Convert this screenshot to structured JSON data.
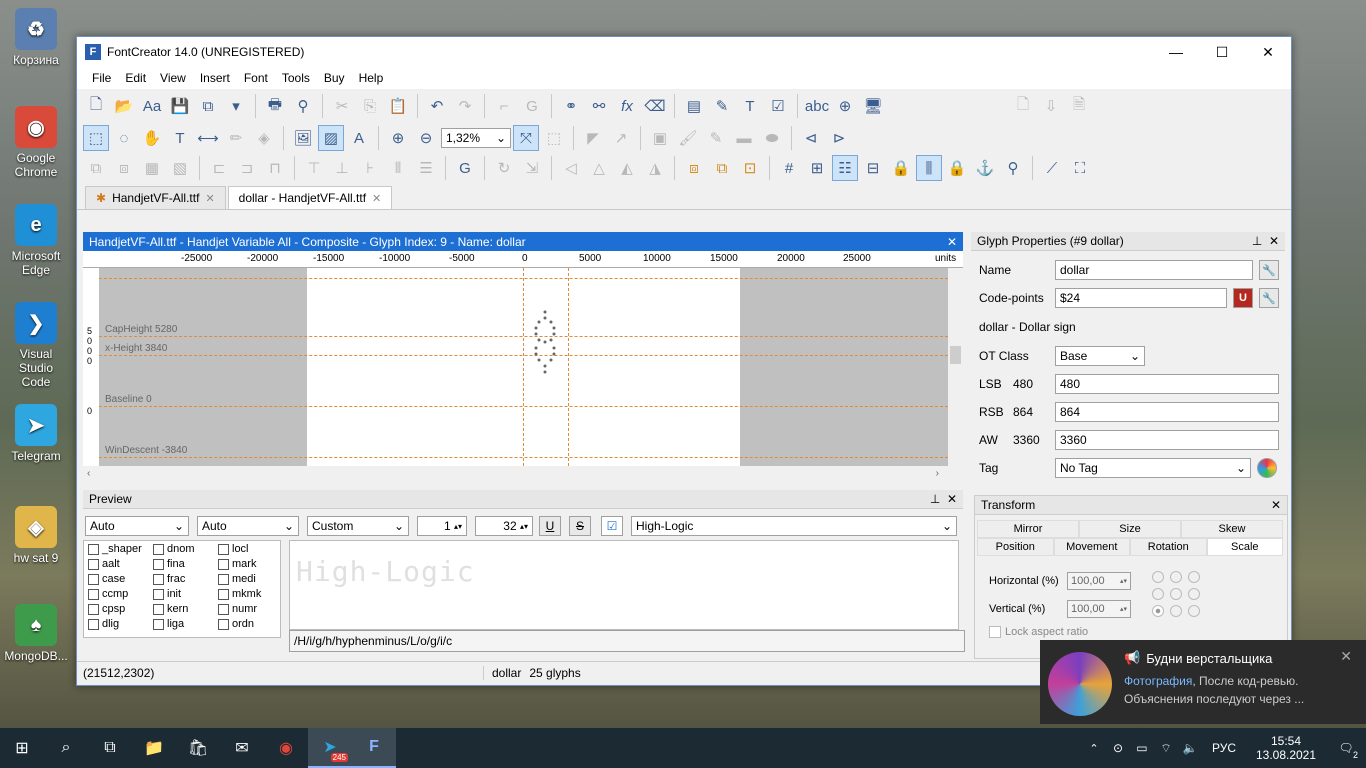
{
  "desktop": {
    "icons": [
      {
        "label": "Корзина",
        "glyph": "♻",
        "color": "#5a7fb0"
      },
      {
        "label": "Google Chrome",
        "glyph": "◉",
        "color": "#d94a3a"
      },
      {
        "label": "Microsoft Edge",
        "glyph": "e",
        "color": "#1f8fd6"
      },
      {
        "label": "Visual Studio Code",
        "glyph": "❯",
        "color": "#1e7fd1"
      },
      {
        "label": "Telegram",
        "glyph": "➤",
        "color": "#2ea6df"
      },
      {
        "label": "hw sat 9",
        "glyph": "◈",
        "color": "#e0b64a"
      },
      {
        "label": "MongoDB...",
        "glyph": "♠",
        "color": "#3e9b4b"
      }
    ]
  },
  "window": {
    "title": "FontCreator 14.0 (UNREGISTERED)",
    "minimize": "—",
    "maximize": "☐",
    "close": "✕"
  },
  "menu": [
    "File",
    "Edit",
    "View",
    "Insert",
    "Font",
    "Tools",
    "Buy",
    "Help"
  ],
  "toolbar": {
    "zoom": "1,32%"
  },
  "tabs": [
    {
      "label": "HandjetVF-All.ttf",
      "active": false
    },
    {
      "label": "dollar - HandjetVF-All.ttf",
      "active": true
    }
  ],
  "glyph_window": {
    "title": "HandjetVF-All.ttf - Handjet Variable All - Composite - Glyph Index: 9 - Name: dollar",
    "ruler_ticks": [
      "-25000",
      "-20000",
      "-15000",
      "-10000",
      "-5000",
      "0",
      "5000",
      "10000",
      "15000",
      "20000",
      "25000",
      "units"
    ],
    "metrics": [
      {
        "label": "CapHeight 5280"
      },
      {
        "label": "x-Height 3840"
      },
      {
        "label": "Baseline 0"
      },
      {
        "label": "WinDescent -3840"
      }
    ],
    "vruler": [
      "5",
      "0",
      "0",
      "0",
      "0"
    ]
  },
  "preview": {
    "title": "Preview",
    "script": "Auto",
    "language": "Auto",
    "mode": "Custom",
    "size_from": "1",
    "size_to": "32",
    "underline": "U",
    "strike": "S",
    "font_combo": "High-Logic",
    "features": [
      "_shaper",
      "aalt",
      "case",
      "ccmp",
      "cpsp",
      "dlig",
      "dnom",
      "fina",
      "frac",
      "init",
      "kern",
      "liga",
      "locl",
      "mark",
      "medi",
      "mkmk",
      "numr",
      "ordn"
    ],
    "sample_text": "High-Logic",
    "glyph_sequence": "/H/i/g/h/hyphenminus/L/o/g/i/c"
  },
  "status": {
    "coords": "(21512,2302)",
    "glyph_name": "dollar",
    "glyph_count": "25 glyphs"
  },
  "glyph_properties": {
    "title": "Glyph Properties (#9 dollar)",
    "name_label": "Name",
    "name_value": "dollar",
    "codepoints_label": "Code-points",
    "codepoints_value": "$24",
    "description": "dollar - Dollar sign",
    "ot_class_label": "OT Class",
    "ot_class_value": "Base",
    "lsb_label": "LSB",
    "lsb_num": "480",
    "lsb_value": "480",
    "rsb_label": "RSB",
    "rsb_num": "864",
    "rsb_value": "864",
    "aw_label": "AW",
    "aw_num": "3360",
    "aw_value": "3360",
    "tag_label": "Tag",
    "tag_value": "No Tag"
  },
  "transform": {
    "title": "Transform",
    "tabs_top": [
      "Mirror",
      "Size",
      "Skew"
    ],
    "tabs_bottom": [
      "Position",
      "Movement",
      "Rotation",
      "Scale"
    ],
    "horizontal_label": "Horizontal (%)",
    "horizontal_value": "100,00",
    "vertical_label": "Vertical (%)",
    "vertical_value": "100,00",
    "lock_label": "Lock aspect ratio"
  },
  "notification": {
    "title": "Будни верстальщика",
    "link": "Фотография",
    "line1_rest": ", После код-ревью.",
    "line2": "Объяснения последуют через ..."
  },
  "taskbar": {
    "lang": "РУС",
    "time": "15:54",
    "date": "13.08.2021",
    "telegram_badge": "245",
    "notif_count": "2"
  }
}
